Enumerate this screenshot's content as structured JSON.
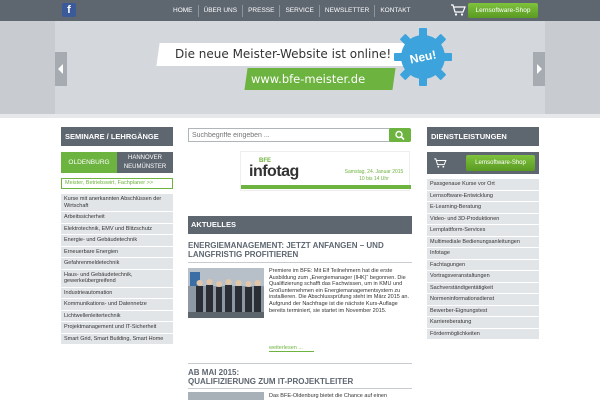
{
  "topbar": {
    "facebook_icon": "facebook-icon",
    "nav": [
      "HOME",
      "ÜBER UNS",
      "PRESSE",
      "SERVICE",
      "NEWSLETTER",
      "KONTAKT"
    ],
    "cart_icon": "cart-icon",
    "shop_button": "Lernsoftware-Shop"
  },
  "banner": {
    "title": "Die neue Meister-Website ist online!",
    "url": "www.bfe-meister.de",
    "badge": "Neu!",
    "colors": {
      "green": "#6db33f",
      "blue": "#3da3dc"
    }
  },
  "left": {
    "heading": "SEMINARE / LEHRGÄNGE",
    "tab_active": "OLDENBURG",
    "tab_other_line1": "HANNOVER",
    "tab_other_line2": "NEUMÜNSTER",
    "meister_link": "Meister, Betriebswirt, Fachplaner >>",
    "items": [
      "Kurse mit anerkannten Abschlüssen der Wirtschaft",
      "Arbeitssicherheit",
      "Elektrotechnik, EMV und Blitzschutz",
      "Energie- und Gebäudetechnik",
      "Erneuerbare Energien",
      "Gefahrenmeldetechnik",
      "Haus- und Gebäudetechnik, gewerkeübergreifend",
      "Industrieautomation",
      "Kommunikations- und Datennetze",
      "Lichtwellenleitertechnik",
      "Projektmanagement und IT-Sicherheit",
      "Smart Grid, Smart Building, Smart Home"
    ]
  },
  "search": {
    "placeholder": "Suchbegriffe eingeben ...",
    "button_icon": "search-icon"
  },
  "infotag": {
    "brand": "BFE",
    "title": "infotag",
    "date": "Samstag, 24. Januar 2015",
    "time": "10 bis 14 Uhr"
  },
  "news": {
    "heading": "AKTUELLES",
    "article1": {
      "title": "ENERGIEMANAGEMENT: JETZT ANFANGEN – UND LANGFRISTIG PROFITIEREN",
      "text": "Premiere im BFE: Mit Elf Teilnehmern hat die erste Ausbildung zum „Energiemanager (IHK)“ begonnen. Die Qualifizierung schafft das Fachwissen, um in KMU und Großunternehmen ein Energiemanagementsystem zu installieren. Die Abschlussprüfung steht im März 2015 an. Aufgrund der Nachfrage ist die nächste Kurs-Auflage bereits terminiert, sie startet im November 2015.",
      "more": "weiterlesen ..."
    },
    "article2": {
      "title_line1": "AB MAI 2015:",
      "title_line2": "QUALIFIZIERUNG ZUM IT-PROJEKTLEITER",
      "text": "Das BFE-Oldenburg bietet die Chance auf einen"
    }
  },
  "right": {
    "heading": "DIENSTLEISTUNGEN",
    "shop_button": "Lernsoftware-Shop",
    "items": [
      "Passgenaue Kurse vor Ort",
      "Lernsoftware-Entwicklung",
      "E-Learning-Beratung",
      "Video- und 3D-Produktionen",
      "Lernplattform-Services",
      "Multimediale Bedienungsanleitungen",
      "Infotage",
      "Fachtagungen",
      "Vortragsveranstaltungen",
      "Sachverständigentätigkeit",
      "Normeninformationsdienst",
      "Bewerber-Eignungstest",
      "Karriereberatung",
      "Fördermöglichkeiten"
    ]
  }
}
